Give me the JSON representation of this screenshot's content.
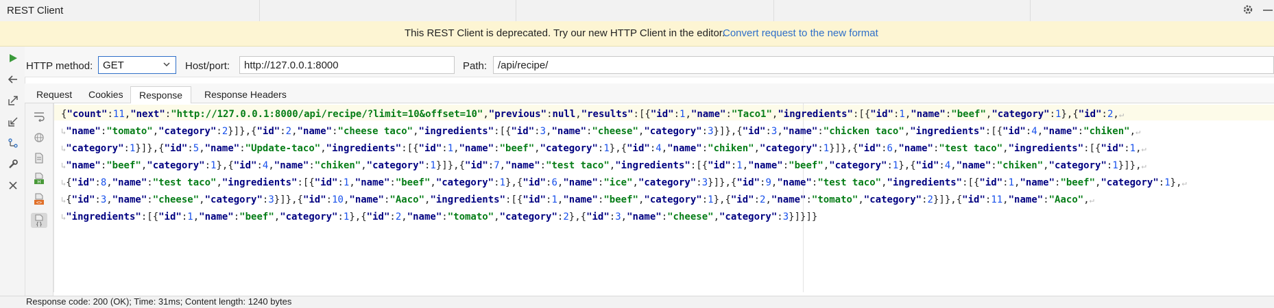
{
  "window": {
    "title": "REST Client"
  },
  "banner": {
    "message": "This REST Client is deprecated. Try our new HTTP Client in the editor.",
    "link": "Convert request to the new format"
  },
  "request": {
    "method_label": "HTTP method:",
    "method_value": "GET",
    "host_label": "Host/port:",
    "host_value": "http://127.0.0.1:8000",
    "path_label": "Path:",
    "path_value": "/api/recipe/"
  },
  "tabs": [
    {
      "label": "Request"
    },
    {
      "label": "Cookies"
    },
    {
      "label": "Response",
      "active": true
    },
    {
      "label": "Response Headers"
    }
  ],
  "response": {
    "lines": [
      "{\"count\":11,\"next\":\"http://127.0.0.1:8000/api/recipe/?limit=10&offset=10\",\"previous\":null,\"results\":[{\"id\":1,\"name\":\"Taco1\",\"ingredients\":[{\"id\":1,\"name\":\"beef\",\"category\":1},{\"id\":2,",
      "\"name\":\"tomato\",\"category\":2}]},{\"id\":2,\"name\":\"cheese taco\",\"ingredients\":[{\"id\":3,\"name\":\"cheese\",\"category\":3}]},{\"id\":3,\"name\":\"chicken taco\",\"ingredients\":[{\"id\":4,\"name\":\"chiken\",",
      "\"category\":1}]},{\"id\":5,\"name\":\"Update-taco\",\"ingredients\":[{\"id\":1,\"name\":\"beef\",\"category\":1},{\"id\":4,\"name\":\"chiken\",\"category\":1}]},{\"id\":6,\"name\":\"test taco\",\"ingredients\":[{\"id\":1,",
      "\"name\":\"beef\",\"category\":1},{\"id\":4,\"name\":\"chiken\",\"category\":1}]},{\"id\":7,\"name\":\"test taco\",\"ingredients\":[{\"id\":1,\"name\":\"beef\",\"category\":1},{\"id\":4,\"name\":\"chiken\",\"category\":1}]},",
      "{\"id\":8,\"name\":\"test taco\",\"ingredients\":[{\"id\":1,\"name\":\"beef\",\"category\":1},{\"id\":6,\"name\":\"ice\",\"category\":3}]},{\"id\":9,\"name\":\"test taco\",\"ingredients\":[{\"id\":1,\"name\":\"beef\",\"category\":1},",
      "{\"id\":3,\"name\":\"cheese\",\"category\":3}]},{\"id\":10,\"name\":\"Aaco\",\"ingredients\":[{\"id\":1,\"name\":\"beef\",\"category\":1},{\"id\":2,\"name\":\"tomato\",\"category\":2}]},{\"id\":11,\"name\":\"Aaco\",",
      "\"ingredients\":[{\"id\":1,\"name\":\"beef\",\"category\":1},{\"id\":2,\"name\":\"tomato\",\"category\":2},{\"id\":3,\"name\":\"cheese\",\"category\":3}]}]}"
    ]
  },
  "status": {
    "text": "Response code: 200 (OK); Time: 31ms; Content length: 1240 bytes"
  },
  "colors": {
    "link": "#2f6fc8",
    "banner_bg": "#fdf5d3",
    "json_key": "#000080",
    "json_string": "#067d17",
    "json_number": "#1750eb",
    "run_icon": "#3a9a3a"
  },
  "icons": {
    "left_toolbar": [
      "run-icon",
      "back-arrow-icon",
      "export-icon",
      "import-icon",
      "network-icon",
      "wrench-icon",
      "close-icon"
    ],
    "response_toolbar": [
      "soft-wrap-icon",
      "globe-icon",
      "file-icon",
      "html-file-icon",
      "xml-file-icon",
      "json-file-icon"
    ]
  }
}
